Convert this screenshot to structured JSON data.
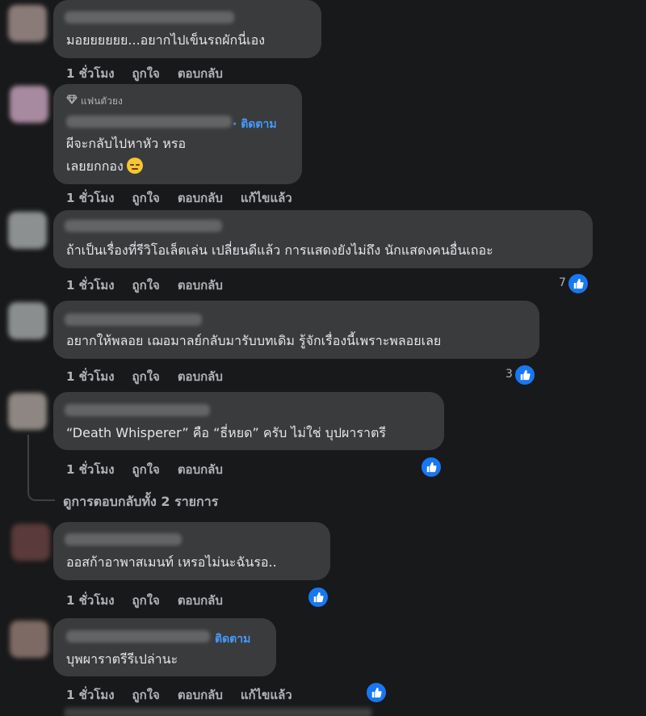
{
  "comments": [
    {
      "text": "มอยยยยยย...อยากไปเข็นรถผักนี่เอง",
      "actions": [
        "1 ชั่วโมง",
        "ถูกใจ",
        "ตอบกลับ"
      ]
    },
    {
      "badge": "แฟนตัวยง",
      "follow": "· ติดตาม",
      "text_lines": [
        "ผีจะกลับไปหาหัว หรอ",
        "เลยยกกอง"
      ],
      "actions": [
        "1 ชั่วโมง",
        "ถูกใจ",
        "ตอบกลับ",
        "แก้ไขแล้ว"
      ]
    },
    {
      "text": "ถ้าเป็นเรื่องที่รีวิโอเล็ตเล่น เปลี่ยนดีแล้ว การแสดงยังไม่ถึง นักแสดงคนอื่นเถอะ",
      "actions": [
        "1 ชั่วโมง",
        "ถูกใจ",
        "ตอบกลับ"
      ],
      "likes": "7"
    },
    {
      "text": "อยากให้พลอย เฌอมาลย์กลับมารับบทเดิม รู้จักเรื่องนี้เพราะพลอยเลย",
      "actions": [
        "1 ชั่วโมง",
        "ถูกใจ",
        "ตอบกลับ"
      ],
      "likes": "3"
    },
    {
      "text": "“Death Whisperer” คือ “ธี่หยด” ครับ ไม่ใช่ บุปผาราตรี",
      "actions": [
        "1 ชั่วโมง",
        "ถูกใจ",
        "ตอบกลับ"
      ],
      "view_replies": "ดูการตอบกลับทั้ง 2 รายการ"
    },
    {
      "text": "ออสก้าอาพาสเมนท์ เหรอไม่นะฉันรอ..",
      "actions": [
        "1 ชั่วโมง",
        "ถูกใจ",
        "ตอบกลับ"
      ]
    },
    {
      "follow": "ติดตาม",
      "text": "บุพผาราตรีรีเปล่านะ",
      "actions": [
        "1 ชั่วโมง",
        "ถูกใจ",
        "ตอบกลับ",
        "แก้ไขแล้ว"
      ]
    }
  ],
  "colors": {
    "background": "#18191a",
    "bubble": "#3a3b3c",
    "text": "#e4e6eb",
    "secondary": "#b0b3b8",
    "accent": "#4599ff",
    "like_blue": "#1877f2"
  },
  "icons": [
    "diamond-icon",
    "like-icon",
    "grimace-emoji-icon"
  ]
}
